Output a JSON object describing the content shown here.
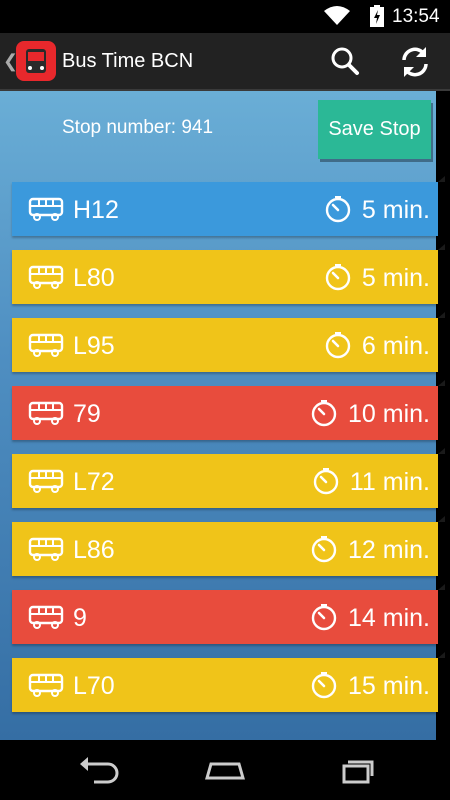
{
  "status_bar": {
    "time": "13:54"
  },
  "app_bar": {
    "title": "Bus Time BCN"
  },
  "stop": {
    "label": "Stop number: 941",
    "save_label": "Save Stop"
  },
  "arrivals": [
    {
      "line": "H12",
      "time": "5 min.",
      "color": "blue"
    },
    {
      "line": "L80",
      "time": "5 min.",
      "color": "yellow"
    },
    {
      "line": "L95",
      "time": "6 min.",
      "color": "yellow"
    },
    {
      "line": "79",
      "time": "10 min.",
      "color": "red"
    },
    {
      "line": "L72",
      "time": "11 min.",
      "color": "yellow"
    },
    {
      "line": "L86",
      "time": "12 min.",
      "color": "yellow"
    },
    {
      "line": "9",
      "time": "14 min.",
      "color": "red"
    },
    {
      "line": "L70",
      "time": "15 min.",
      "color": "yellow"
    }
  ],
  "colors": {
    "blue": "#3b99dc",
    "yellow": "#f0c419",
    "red": "#e84c3d",
    "accent": "#2bb896"
  },
  "icons": [
    "wifi-icon",
    "battery-icon",
    "bus-icon",
    "timer-icon",
    "search-icon",
    "refresh-icon",
    "back-icon",
    "home-icon",
    "recents-icon"
  ]
}
